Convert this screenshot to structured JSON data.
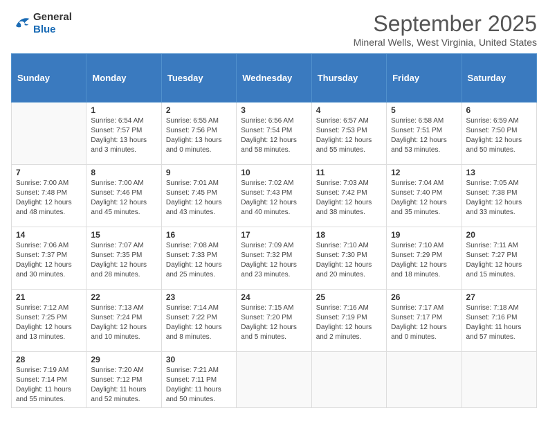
{
  "header": {
    "logo": {
      "general": "General",
      "blue": "Blue"
    },
    "title": "September 2025",
    "location": "Mineral Wells, West Virginia, United States"
  },
  "weekdays": [
    "Sunday",
    "Monday",
    "Tuesday",
    "Wednesday",
    "Thursday",
    "Friday",
    "Saturday"
  ],
  "weeks": [
    [
      {
        "day": "",
        "sunrise": "",
        "sunset": "",
        "daylight": ""
      },
      {
        "day": "1",
        "sunrise": "Sunrise: 6:54 AM",
        "sunset": "Sunset: 7:57 PM",
        "daylight": "Daylight: 13 hours and 3 minutes."
      },
      {
        "day": "2",
        "sunrise": "Sunrise: 6:55 AM",
        "sunset": "Sunset: 7:56 PM",
        "daylight": "Daylight: 13 hours and 0 minutes."
      },
      {
        "day": "3",
        "sunrise": "Sunrise: 6:56 AM",
        "sunset": "Sunset: 7:54 PM",
        "daylight": "Daylight: 12 hours and 58 minutes."
      },
      {
        "day": "4",
        "sunrise": "Sunrise: 6:57 AM",
        "sunset": "Sunset: 7:53 PM",
        "daylight": "Daylight: 12 hours and 55 minutes."
      },
      {
        "day": "5",
        "sunrise": "Sunrise: 6:58 AM",
        "sunset": "Sunset: 7:51 PM",
        "daylight": "Daylight: 12 hours and 53 minutes."
      },
      {
        "day": "6",
        "sunrise": "Sunrise: 6:59 AM",
        "sunset": "Sunset: 7:50 PM",
        "daylight": "Daylight: 12 hours and 50 minutes."
      }
    ],
    [
      {
        "day": "7",
        "sunrise": "Sunrise: 7:00 AM",
        "sunset": "Sunset: 7:48 PM",
        "daylight": "Daylight: 12 hours and 48 minutes."
      },
      {
        "day": "8",
        "sunrise": "Sunrise: 7:00 AM",
        "sunset": "Sunset: 7:46 PM",
        "daylight": "Daylight: 12 hours and 45 minutes."
      },
      {
        "day": "9",
        "sunrise": "Sunrise: 7:01 AM",
        "sunset": "Sunset: 7:45 PM",
        "daylight": "Daylight: 12 hours and 43 minutes."
      },
      {
        "day": "10",
        "sunrise": "Sunrise: 7:02 AM",
        "sunset": "Sunset: 7:43 PM",
        "daylight": "Daylight: 12 hours and 40 minutes."
      },
      {
        "day": "11",
        "sunrise": "Sunrise: 7:03 AM",
        "sunset": "Sunset: 7:42 PM",
        "daylight": "Daylight: 12 hours and 38 minutes."
      },
      {
        "day": "12",
        "sunrise": "Sunrise: 7:04 AM",
        "sunset": "Sunset: 7:40 PM",
        "daylight": "Daylight: 12 hours and 35 minutes."
      },
      {
        "day": "13",
        "sunrise": "Sunrise: 7:05 AM",
        "sunset": "Sunset: 7:38 PM",
        "daylight": "Daylight: 12 hours and 33 minutes."
      }
    ],
    [
      {
        "day": "14",
        "sunrise": "Sunrise: 7:06 AM",
        "sunset": "Sunset: 7:37 PM",
        "daylight": "Daylight: 12 hours and 30 minutes."
      },
      {
        "day": "15",
        "sunrise": "Sunrise: 7:07 AM",
        "sunset": "Sunset: 7:35 PM",
        "daylight": "Daylight: 12 hours and 28 minutes."
      },
      {
        "day": "16",
        "sunrise": "Sunrise: 7:08 AM",
        "sunset": "Sunset: 7:33 PM",
        "daylight": "Daylight: 12 hours and 25 minutes."
      },
      {
        "day": "17",
        "sunrise": "Sunrise: 7:09 AM",
        "sunset": "Sunset: 7:32 PM",
        "daylight": "Daylight: 12 hours and 23 minutes."
      },
      {
        "day": "18",
        "sunrise": "Sunrise: 7:10 AM",
        "sunset": "Sunset: 7:30 PM",
        "daylight": "Daylight: 12 hours and 20 minutes."
      },
      {
        "day": "19",
        "sunrise": "Sunrise: 7:10 AM",
        "sunset": "Sunset: 7:29 PM",
        "daylight": "Daylight: 12 hours and 18 minutes."
      },
      {
        "day": "20",
        "sunrise": "Sunrise: 7:11 AM",
        "sunset": "Sunset: 7:27 PM",
        "daylight": "Daylight: 12 hours and 15 minutes."
      }
    ],
    [
      {
        "day": "21",
        "sunrise": "Sunrise: 7:12 AM",
        "sunset": "Sunset: 7:25 PM",
        "daylight": "Daylight: 12 hours and 13 minutes."
      },
      {
        "day": "22",
        "sunrise": "Sunrise: 7:13 AM",
        "sunset": "Sunset: 7:24 PM",
        "daylight": "Daylight: 12 hours and 10 minutes."
      },
      {
        "day": "23",
        "sunrise": "Sunrise: 7:14 AM",
        "sunset": "Sunset: 7:22 PM",
        "daylight": "Daylight: 12 hours and 8 minutes."
      },
      {
        "day": "24",
        "sunrise": "Sunrise: 7:15 AM",
        "sunset": "Sunset: 7:20 PM",
        "daylight": "Daylight: 12 hours and 5 minutes."
      },
      {
        "day": "25",
        "sunrise": "Sunrise: 7:16 AM",
        "sunset": "Sunset: 7:19 PM",
        "daylight": "Daylight: 12 hours and 2 minutes."
      },
      {
        "day": "26",
        "sunrise": "Sunrise: 7:17 AM",
        "sunset": "Sunset: 7:17 PM",
        "daylight": "Daylight: 12 hours and 0 minutes."
      },
      {
        "day": "27",
        "sunrise": "Sunrise: 7:18 AM",
        "sunset": "Sunset: 7:16 PM",
        "daylight": "Daylight: 11 hours and 57 minutes."
      }
    ],
    [
      {
        "day": "28",
        "sunrise": "Sunrise: 7:19 AM",
        "sunset": "Sunset: 7:14 PM",
        "daylight": "Daylight: 11 hours and 55 minutes."
      },
      {
        "day": "29",
        "sunrise": "Sunrise: 7:20 AM",
        "sunset": "Sunset: 7:12 PM",
        "daylight": "Daylight: 11 hours and 52 minutes."
      },
      {
        "day": "30",
        "sunrise": "Sunrise: 7:21 AM",
        "sunset": "Sunset: 7:11 PM",
        "daylight": "Daylight: 11 hours and 50 minutes."
      },
      {
        "day": "",
        "sunrise": "",
        "sunset": "",
        "daylight": ""
      },
      {
        "day": "",
        "sunrise": "",
        "sunset": "",
        "daylight": ""
      },
      {
        "day": "",
        "sunrise": "",
        "sunset": "",
        "daylight": ""
      },
      {
        "day": "",
        "sunrise": "",
        "sunset": "",
        "daylight": ""
      }
    ]
  ]
}
